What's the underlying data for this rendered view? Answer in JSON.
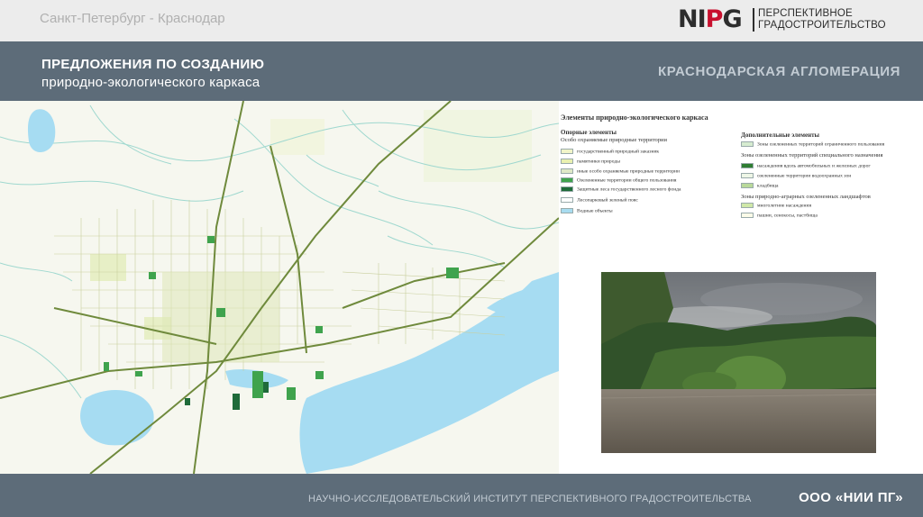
{
  "topbar": {
    "route": "Санкт-Петербург - Краснодар",
    "logo_mark_left": "NI",
    "logo_mark_accent": "P",
    "logo_mark_right": "G",
    "logo_line1": "ПЕРСПЕКТИВНОЕ",
    "logo_line2": "ГРАДОСТРОИТЕЛЬСТВО"
  },
  "header": {
    "title_line1": "ПРЕДЛОЖЕНИЯ ПО СОЗДАНИЮ",
    "title_line2": "природно-экологического каркаса",
    "region": "КРАСНОДАРСКАЯ АГЛОМЕРАЦИЯ"
  },
  "legend": {
    "title": "Элементы природно-экологического каркаса",
    "core_heading": "Опорные элементы",
    "core_subheading": "Особо охраняемые природные территории",
    "core_items": [
      {
        "label": "государственный природный заказник",
        "color": "#f1f4c8"
      },
      {
        "label": "памятники природы",
        "color": "#e9f0b0"
      },
      {
        "label": "иные особо охраняемые природные территории",
        "color": "#dfe9c7"
      },
      {
        "label": "Озелененные территории общего пользования",
        "color": "#3fa34d"
      },
      {
        "label": "Защитные леса государственного лесного фонда",
        "color": "#1f6b3a"
      },
      {
        "label": "Лесопарковый зеленый пояс",
        "color": "#ffffff"
      },
      {
        "label": "Водные объекты",
        "color": "#a8dcf0"
      }
    ],
    "extra_heading": "Дополнительные элементы",
    "extra_items": [
      {
        "label": "Зоны озелененных территорий ограниченного пользования",
        "color": "#d6ecd0"
      }
    ],
    "special_heading": "Зоны озелененных территорий специального назначения",
    "special_items": [
      {
        "label": "насаждения вдоль автомобильных и железных дорог",
        "color": "#2e7d32"
      },
      {
        "label": "озелененные территории водоохранных зон",
        "color": "#eef6e6"
      },
      {
        "label": "кладбища",
        "color": "#b9d99a"
      }
    ],
    "agro_heading": "Зоны природно-аграрных озелененных ландшафтов",
    "agro_items": [
      {
        "label": "многолетние насаждения",
        "color": "#cfe8a8"
      },
      {
        "label": "пашни, сенокосы, пастбища",
        "color": "#fbfbe8"
      }
    ]
  },
  "footer": {
    "institute": "НАУЧНО-ИССЛЕДОВАТЕЛЬСКИЙ ИНСТИТУТ ПЕРСПЕКТИВНОГО ГРАДОСТРОИТЕЛЬСТВА",
    "company": "ООО «НИИ ПГ»"
  }
}
